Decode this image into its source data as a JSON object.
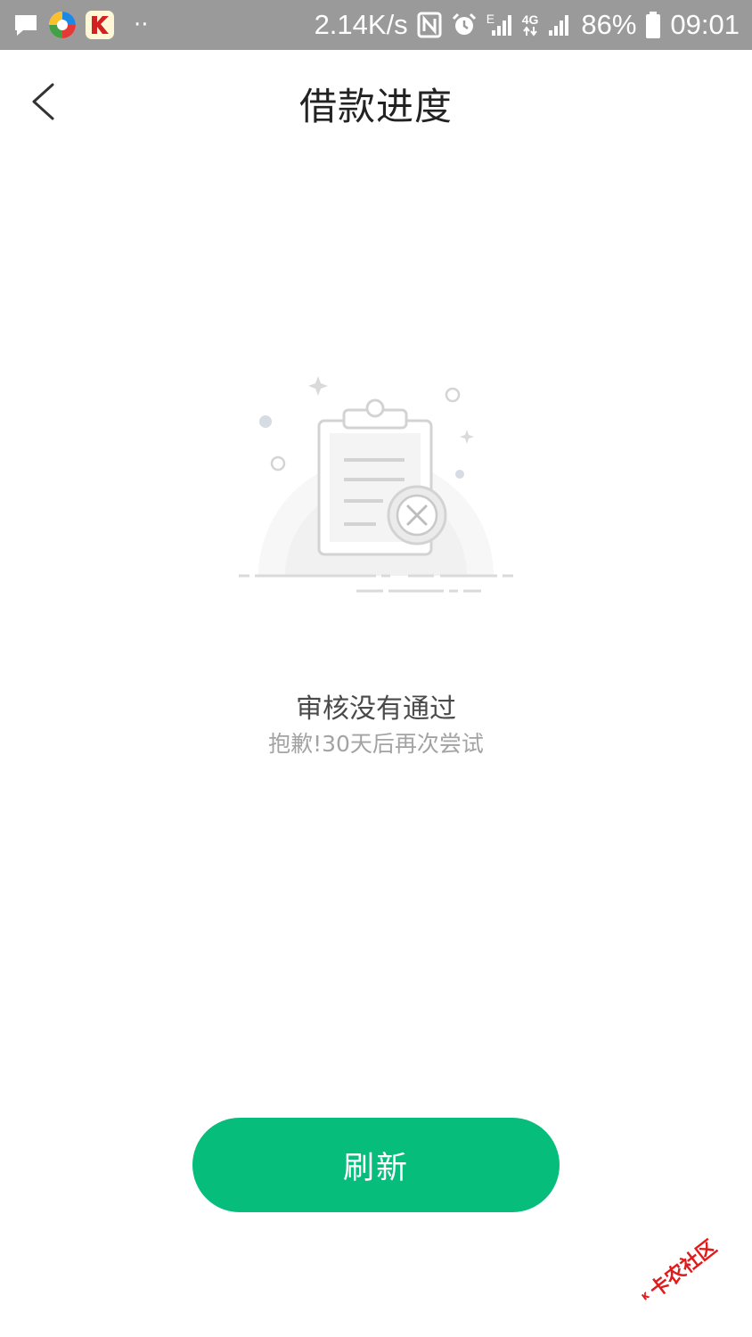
{
  "status_bar": {
    "net_speed": "2.14K/s",
    "network_type": "4G",
    "sim_e": "E",
    "battery": "86%",
    "time": "09:01",
    "dots": "··"
  },
  "nav": {
    "title": "借款进度"
  },
  "result": {
    "title": "审核没有通过",
    "subtitle": "抱歉!30天后再次尝试"
  },
  "actions": {
    "refresh_label": "刷新"
  },
  "watermark": {
    "text": "卡农社区"
  },
  "colors": {
    "accent": "#07bd7c",
    "status_bar_bg": "#9a9a9a"
  }
}
